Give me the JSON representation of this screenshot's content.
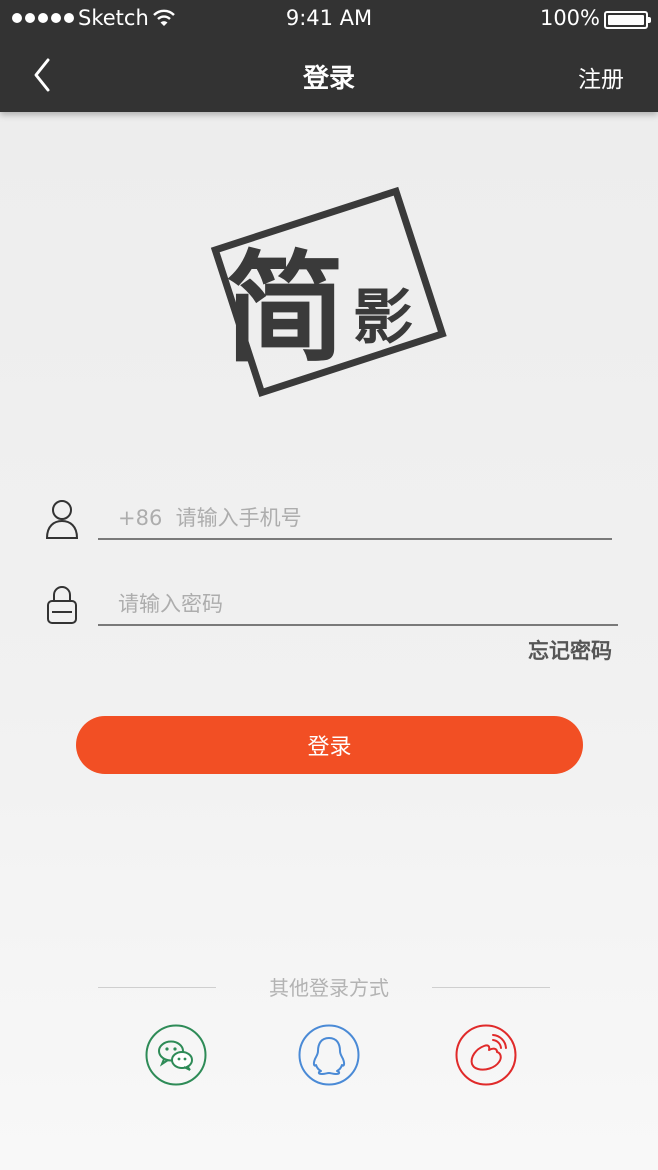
{
  "status_bar": {
    "carrier": "Sketch",
    "time": "9:41 AM",
    "battery": "100%"
  },
  "nav": {
    "title": "登录",
    "right_action": "注册",
    "back_icon": "chevron-left-icon"
  },
  "logo": {
    "text_big": "简",
    "text_small": "影"
  },
  "form": {
    "phone_placeholder": "+86  请输入手机号",
    "password_placeholder": "请输入密码",
    "forgot_label": "忘记密码",
    "login_label": "登录"
  },
  "other_login": {
    "label": "其他登录方式",
    "providers": [
      {
        "name": "wechat",
        "icon": "wechat-icon",
        "color": "#2e8b57"
      },
      {
        "name": "qq",
        "icon": "qq-icon",
        "color": "#4a8ad6"
      },
      {
        "name": "weibo",
        "icon": "weibo-icon",
        "color": "#e02a2a"
      }
    ]
  },
  "colors": {
    "nav_bg": "#333333",
    "accent": "#f24f24"
  }
}
